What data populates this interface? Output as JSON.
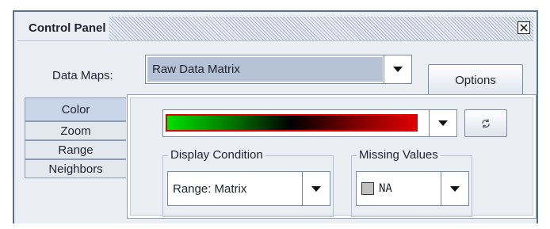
{
  "window": {
    "title": "Control Panel",
    "close_symbol": "☒"
  },
  "data_maps": {
    "label": "Data Maps:",
    "selected": "Raw Data Matrix"
  },
  "options_button": "Options",
  "tabs": [
    {
      "label": "Color",
      "active": true
    },
    {
      "label": "Zoom",
      "active": false
    },
    {
      "label": "Range",
      "active": false
    },
    {
      "label": "Neighbors",
      "active": false
    }
  ],
  "color_tab": {
    "gradient": {
      "colors": [
        "#00e000",
        "#000000",
        "#e00000"
      ]
    },
    "refresh_symbol": "⟳",
    "display_condition": {
      "legend": "Display Condition",
      "selected": "Range: Matrix"
    },
    "missing_values": {
      "legend": "Missing Values",
      "selected": "NA",
      "swatch_color": "#c0c0c0"
    }
  }
}
